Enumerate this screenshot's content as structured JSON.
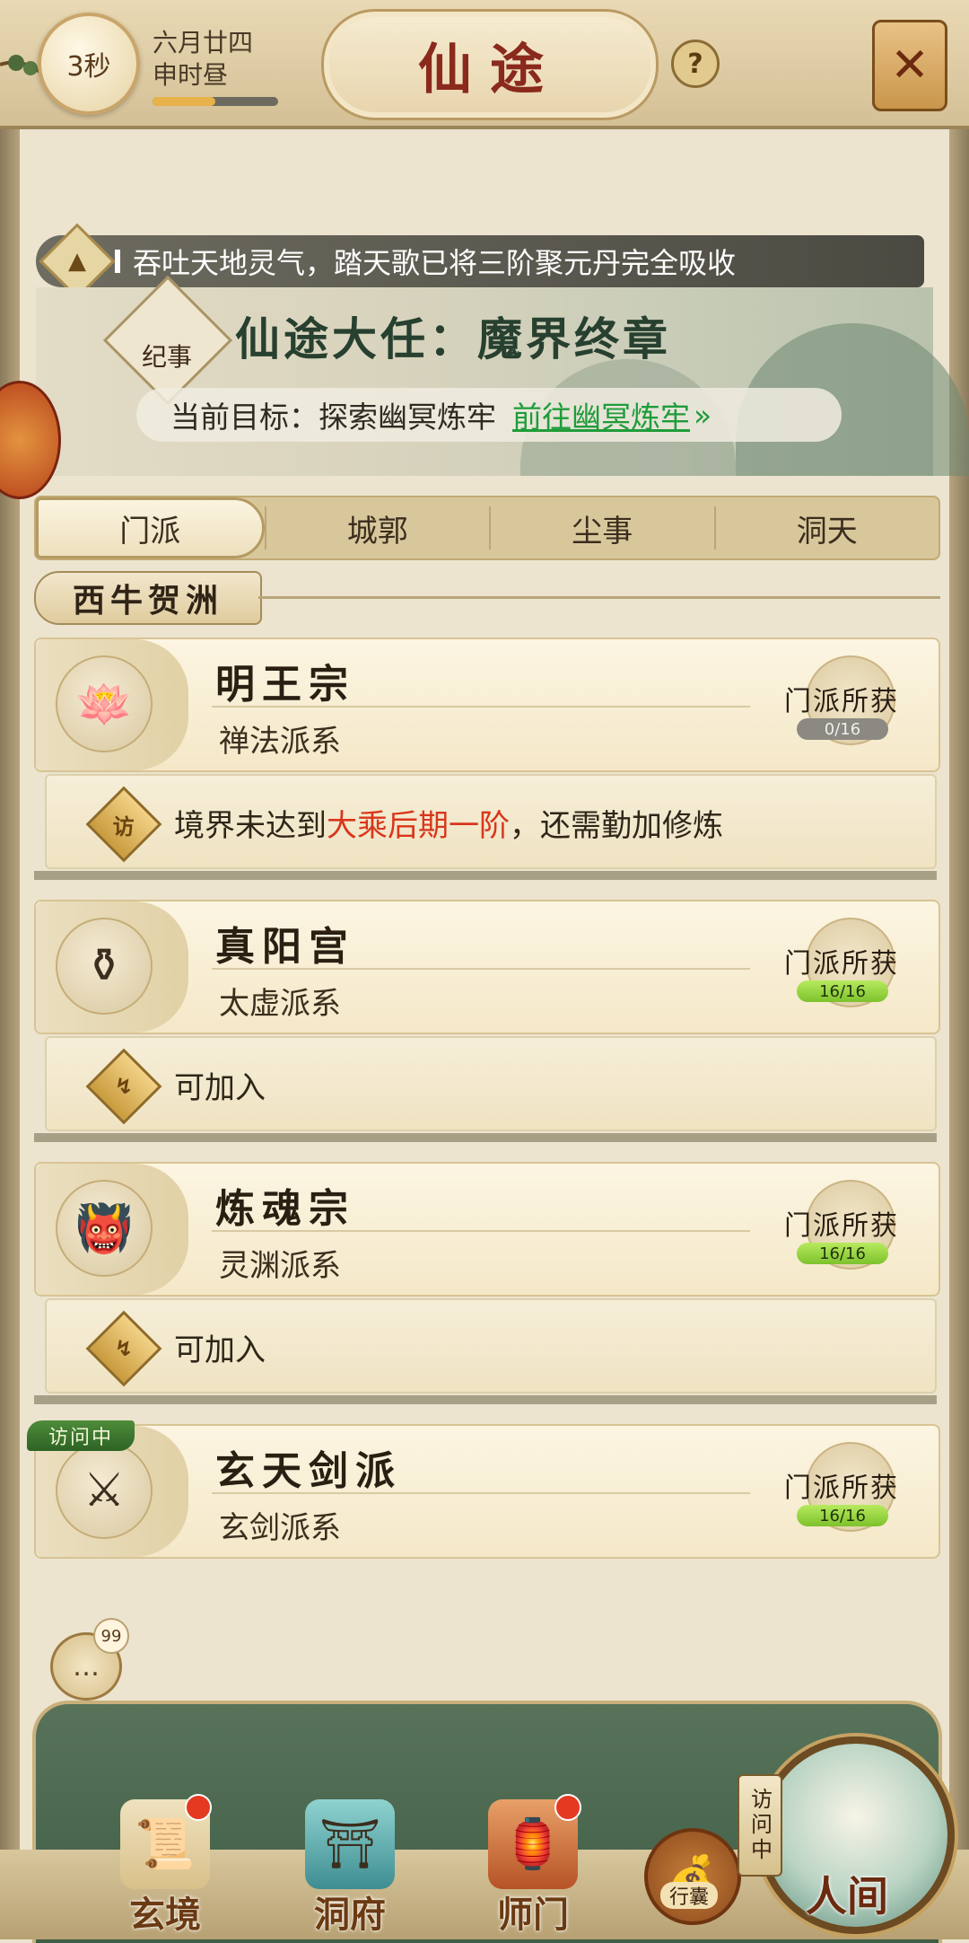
{
  "header": {
    "timer": "3秒",
    "date": "六月廿四",
    "time_of_day": "申时昼",
    "time_progress": 0.5,
    "title": "仙途"
  },
  "icons": {
    "help": "?",
    "close": "✕",
    "notice": "▲",
    "status_visit": "访",
    "status_join": "↯",
    "chat": "…"
  },
  "notice": {
    "text": "吞吐天地灵气，踏天歌已将三阶聚元丹完全吸收"
  },
  "story": {
    "badge": "纪事",
    "title": "仙途大任：魔界终章",
    "target_label": "当前目标：探索幽冥炼牢",
    "target_link": "前往幽冥炼牢",
    "target_arrow": "»"
  },
  "tabs": [
    "门派",
    "城郭",
    "尘事",
    "洞天"
  ],
  "region": "西牛贺洲",
  "sects": [
    {
      "name": "明王宗",
      "type": "禅法派系",
      "badge": "门派所获",
      "count": "0/16",
      "status": "境界未达到大乘后期一阶，还需勤加修炼",
      "status_prefix": "境界未达到",
      "status_highlight": "大乘后期一阶",
      "status_suffix": "，还需勤加修炼",
      "emblem": "🪷"
    },
    {
      "name": "真阳宫",
      "type": "太虚派系",
      "badge": "门派所获",
      "count": "16/16",
      "status": "可加入",
      "emblem": "⚱"
    },
    {
      "name": "炼魂宗",
      "type": "灵渊派系",
      "badge": "门派所获",
      "count": "16/16",
      "status": "可加入",
      "emblem": "👹"
    },
    {
      "name": "玄天剑派",
      "type": "玄剑派系",
      "badge": "门派所获",
      "count": "16/16",
      "visit_tag": "访问中",
      "emblem": "⚔"
    }
  ],
  "chat": {
    "count": "99"
  },
  "nav": {
    "items": [
      {
        "label": "玄境",
        "icon": "📜"
      },
      {
        "label": "洞府",
        "icon": "⛩"
      },
      {
        "label": "师门",
        "icon": "🏮"
      }
    ],
    "bag_label": "行囊",
    "bag_icon": "💰",
    "world_tag": "访问中",
    "world_label": "人间"
  },
  "colors": {
    "accent_red": "#d8361c",
    "link_green": "#1f9c3a",
    "title_red": "#8a2a1c"
  }
}
